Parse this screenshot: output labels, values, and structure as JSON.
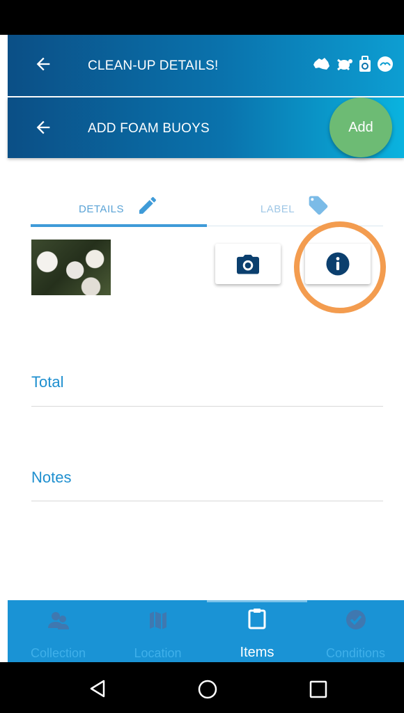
{
  "header": {
    "title": "CLEAN-UP DETAILS!",
    "sub_title": "ADD FOAM BUOYS",
    "add_label": "Add",
    "logo_icons": [
      "australia-icon",
      "turtle-icon",
      "recycle-bag-icon",
      "bird-icon"
    ]
  },
  "tabs": [
    {
      "label": "DETAILS",
      "icon": "pencil-icon",
      "active": true
    },
    {
      "label": "LABEL",
      "icon": "tag-icon",
      "active": false
    }
  ],
  "fields": {
    "total_label": "Total",
    "notes_label": "Notes"
  },
  "bottom_nav": [
    {
      "label": "Collection",
      "icon": "people-icon",
      "active": false
    },
    {
      "label": "Location",
      "icon": "map-icon",
      "active": false
    },
    {
      "label": "Items",
      "icon": "clipboard-icon",
      "active": true
    },
    {
      "label": "Conditions",
      "icon": "check-circle-icon",
      "active": false
    }
  ],
  "colors": {
    "header_dark": "#0b4f86",
    "header_light": "#0d9ed2",
    "accent_blue": "#1e8fcf",
    "fab_green": "#6dbb74",
    "highlight_orange": "#f39c4f",
    "nav_bg": "#1a93d5"
  }
}
